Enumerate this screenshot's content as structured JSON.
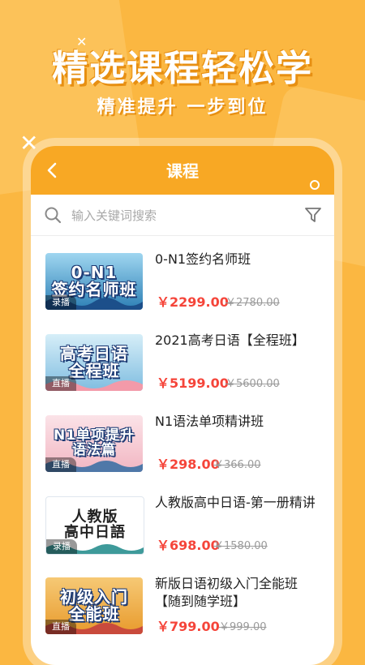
{
  "hero": {
    "title": "精选课程轻松学",
    "subtitle": "精准提升  一步到位"
  },
  "appbar": {
    "title": "课程"
  },
  "search": {
    "placeholder": "输入关键词搜索"
  },
  "courses": [
    {
      "title": "0-N1签约名师班",
      "price": "￥2299.00",
      "original_price": "￥2780.00",
      "thumb_text": "0-N1\n签约名师班",
      "badge": "录播",
      "thumb_color": "#2c7fb5"
    },
    {
      "title": "2021高考日语【全程班】",
      "price": "￥5199.00",
      "original_price": "￥5600.00",
      "thumb_text": "高考日语\n全程班",
      "badge": "直播",
      "thumb_color": "#7fbde0"
    },
    {
      "title": "N1语法单项精讲班",
      "price": "￥298.00",
      "original_price": "￥366.00",
      "thumb_text": "N1单项提升\n语法篇",
      "badge": "直播",
      "thumb_color": "#f2b6c2"
    },
    {
      "title": "人教版高中日语-第一册精讲",
      "price": "￥698.00",
      "original_price": "￥1580.00",
      "thumb_text": "人教版\n高中日語",
      "badge": "录播",
      "thumb_color": "#ffffff"
    },
    {
      "title": "新版日语初级入门全能班【随到随学班】",
      "price": "￥799.00",
      "original_price": "￥999.00",
      "thumb_text": "初级入门\n全能班",
      "badge": "直播",
      "thumb_color": "#f0b54a"
    }
  ],
  "colors": {
    "background": "#fbb741",
    "accent": "#f8a824",
    "price": "#f5453a"
  }
}
